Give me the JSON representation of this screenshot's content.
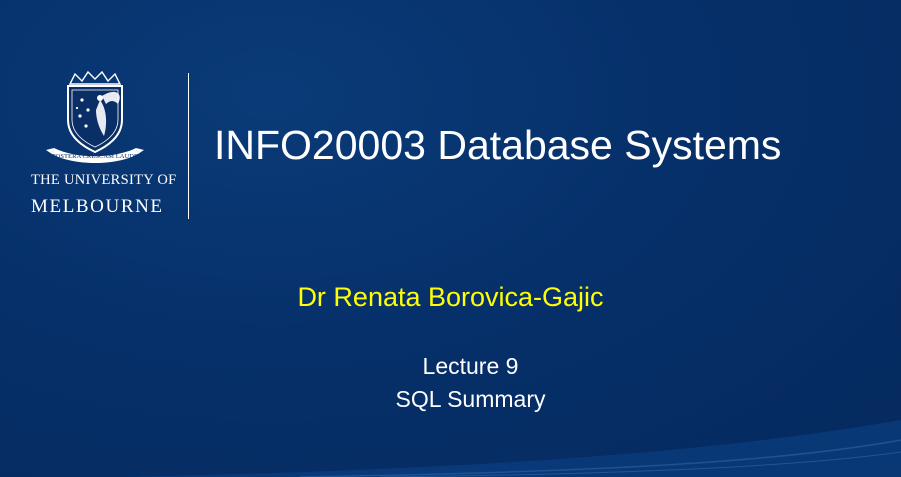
{
  "logo": {
    "motto": "POSTERA CRESCAM LAUDE",
    "university_line1": "THE UNIVERSITY OF",
    "university_line2": "MELBOURNE"
  },
  "slide": {
    "title": "INFO20003 Database Systems",
    "presenter": "Dr Renata Borovica-Gajic",
    "lecture": "Lecture 9",
    "subtitle": "SQL Summary"
  },
  "colors": {
    "background": "#06306a",
    "title_text": "#ffffff",
    "presenter_text": "#ffff00"
  }
}
